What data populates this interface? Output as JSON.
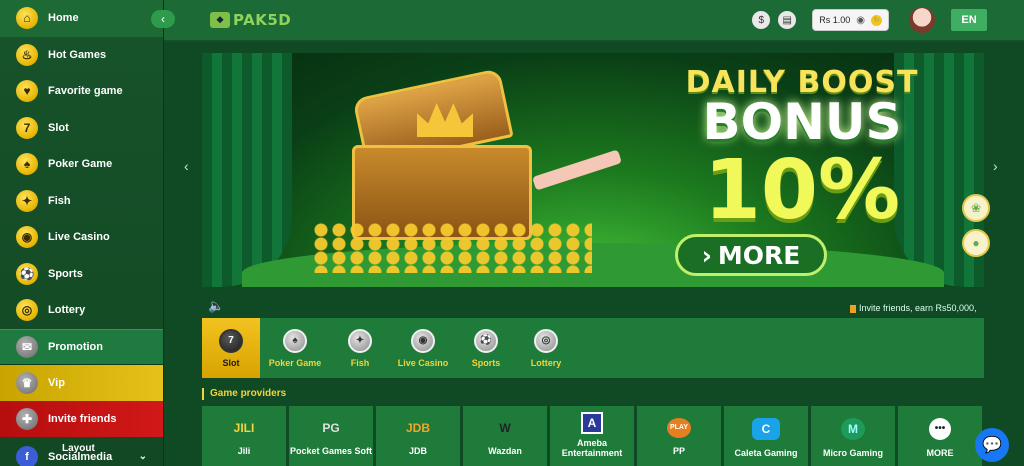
{
  "sidebar": {
    "items": [
      {
        "label": "Home",
        "icon": "home-icon"
      },
      {
        "label": "Hot Games",
        "icon": "hot-games-icon"
      },
      {
        "label": "Favorite game",
        "icon": "favorite-icon"
      },
      {
        "label": "Slot",
        "icon": "slot-icon"
      },
      {
        "label": "Poker Game",
        "icon": "poker-icon"
      },
      {
        "label": "Fish",
        "icon": "fish-icon"
      },
      {
        "label": "Live Casino",
        "icon": "live-casino-icon"
      },
      {
        "label": "Sports",
        "icon": "sports-icon"
      },
      {
        "label": "Lottery",
        "icon": "lottery-icon"
      },
      {
        "label": "Promotion",
        "icon": "promotion-icon"
      },
      {
        "label": "Vip",
        "icon": "vip-icon"
      },
      {
        "label": "Invite friends",
        "icon": "invite-icon"
      },
      {
        "label": "Socialmedia",
        "overlay": "Layout",
        "icon": "facebook-icon"
      }
    ]
  },
  "header": {
    "logo_text": "PAK5D",
    "balance": "Rs 1.00",
    "language": "EN"
  },
  "banner": {
    "line1": "DAILY BOOST",
    "line2": "BONUS",
    "line3": "10%",
    "button": "MORE"
  },
  "marquee": "Invite friends, earn Rs50,000,",
  "categories": [
    {
      "label": "Slot",
      "active": true
    },
    {
      "label": "Poker Game"
    },
    {
      "label": "Fish"
    },
    {
      "label": "Live Casino"
    },
    {
      "label": "Sports"
    },
    {
      "label": "Lottery"
    }
  ],
  "providers_title": "Game providers",
  "providers": [
    {
      "name": "Jili",
      "logo": "JILI"
    },
    {
      "name": "Pocket Games Soft",
      "logo": "PG"
    },
    {
      "name": "JDB",
      "logo": "JDB"
    },
    {
      "name": "Wazdan",
      "logo": "W"
    },
    {
      "name": "Ameba Entertainment",
      "logo": "A"
    },
    {
      "name": "PP",
      "logo": "PLAY"
    },
    {
      "name": "Caleta Gaming",
      "logo": "C"
    },
    {
      "name": "Micro Gaming",
      "logo": "M"
    },
    {
      "name": "MORE",
      "logo": "•••"
    }
  ]
}
